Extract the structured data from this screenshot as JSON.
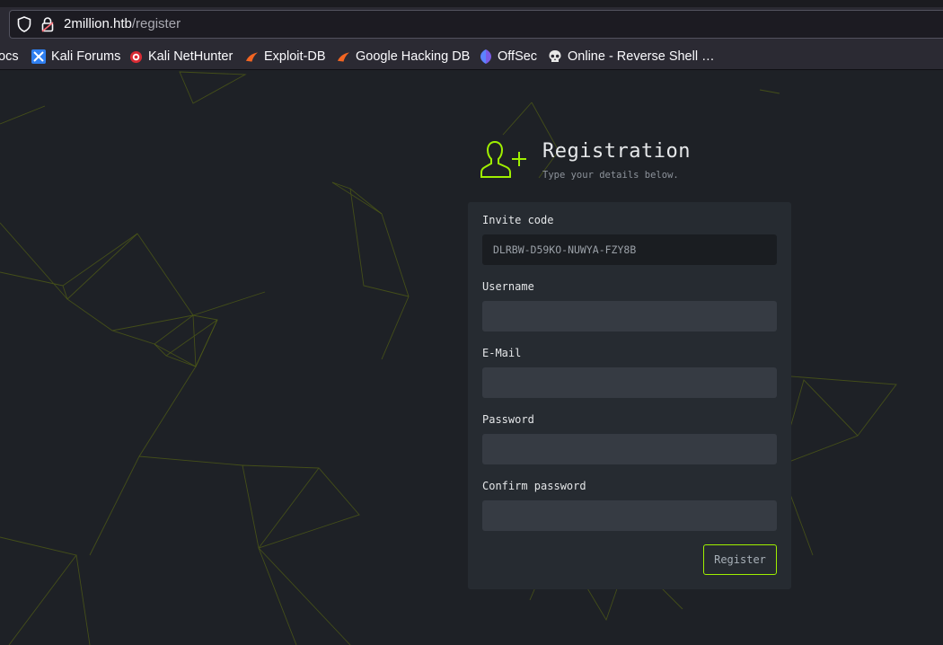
{
  "browser": {
    "url_host": "2million.htb",
    "url_path": "/register",
    "bookmarks": [
      {
        "label": "ocs",
        "icon": "doc-icon"
      },
      {
        "label": "Kali Forums",
        "icon": "kali-forums-icon"
      },
      {
        "label": "Kali NetHunter",
        "icon": "nethunter-icon"
      },
      {
        "label": "Exploit-DB",
        "icon": "exploitdb-icon"
      },
      {
        "label": "Google Hacking DB",
        "icon": "ghdb-icon"
      },
      {
        "label": "OffSec",
        "icon": "offsec-icon"
      },
      {
        "label": "Online - Reverse Shell …",
        "icon": "skull-icon"
      }
    ]
  },
  "registration": {
    "title": "Registration",
    "subtitle": "Type your details below.",
    "accent_color": "#9fef00",
    "fields": {
      "invite_code": {
        "label": "Invite code",
        "value": "DLRBW-D59KO-NUWYA-FZY8B"
      },
      "username": {
        "label": "Username",
        "value": ""
      },
      "email": {
        "label": "E-Mail",
        "value": ""
      },
      "password": {
        "label": "Password",
        "value": ""
      },
      "confirm_password": {
        "label": "Confirm password",
        "value": ""
      }
    },
    "submit_label": "Register"
  }
}
